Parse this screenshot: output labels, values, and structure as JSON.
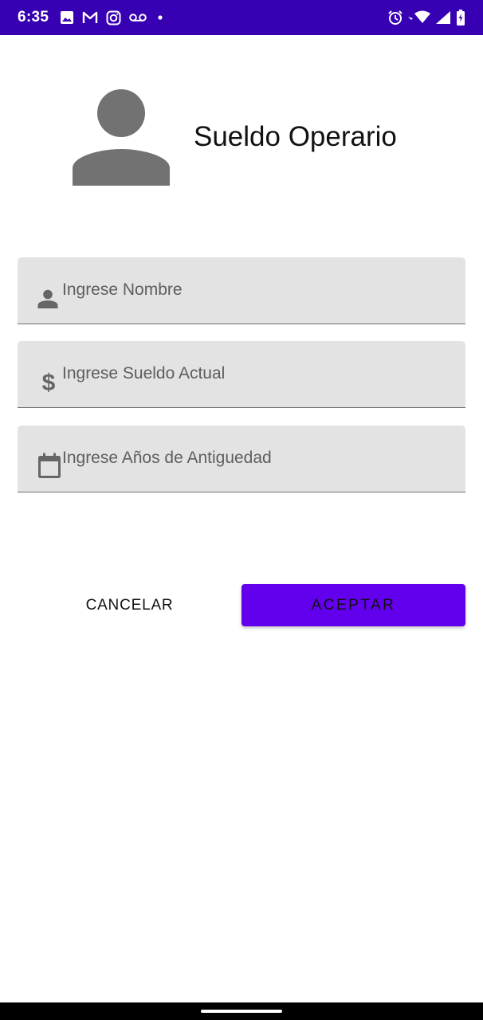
{
  "status_bar": {
    "time": "6:35",
    "left_icons": [
      "image-icon",
      "gmail-icon",
      "instagram-icon",
      "voicemail-icon",
      "dot-icon"
    ],
    "right_icons": [
      "alarm-icon",
      "wifi-icon",
      "signal-icon",
      "battery-icon"
    ],
    "background_color": "#3700b3"
  },
  "header": {
    "avatar_icon": "person-icon",
    "title": "Sueldo Operario"
  },
  "form": {
    "fields": [
      {
        "icon": "person-icon",
        "placeholder": "Ingrese Nombre",
        "value": ""
      },
      {
        "icon": "dollar-icon",
        "placeholder": "Ingrese Sueldo Actual",
        "value": ""
      },
      {
        "icon": "calendar-icon",
        "placeholder": "Ingrese Años de Antiguedad",
        "value": ""
      }
    ]
  },
  "actions": {
    "cancel_label": "CANCELAR",
    "accept_label": "ACEPTAR",
    "accent_color": "#6200ee"
  }
}
